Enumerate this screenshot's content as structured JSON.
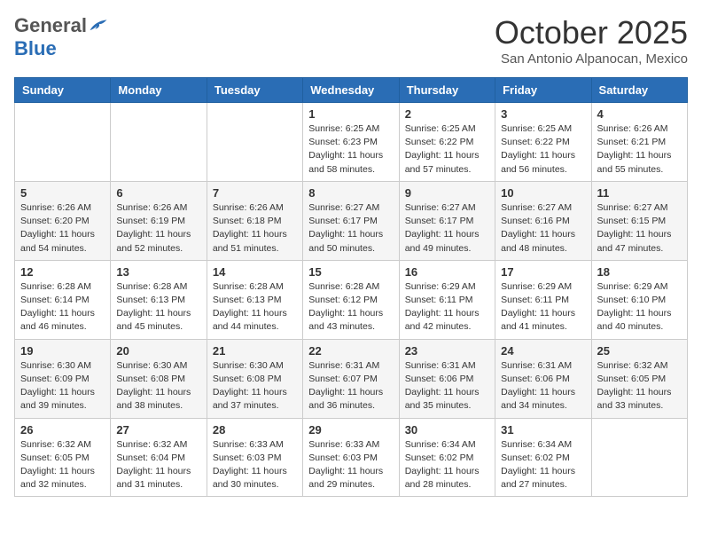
{
  "logo": {
    "general": "General",
    "blue": "Blue"
  },
  "header": {
    "month": "October 2025",
    "location": "San Antonio Alpanocan, Mexico"
  },
  "weekdays": [
    "Sunday",
    "Monday",
    "Tuesday",
    "Wednesday",
    "Thursday",
    "Friday",
    "Saturday"
  ],
  "weeks": [
    [
      {
        "day": "",
        "sunrise": "",
        "sunset": "",
        "daylight": ""
      },
      {
        "day": "",
        "sunrise": "",
        "sunset": "",
        "daylight": ""
      },
      {
        "day": "",
        "sunrise": "",
        "sunset": "",
        "daylight": ""
      },
      {
        "day": "1",
        "sunrise": "Sunrise: 6:25 AM",
        "sunset": "Sunset: 6:23 PM",
        "daylight": "Daylight: 11 hours and 58 minutes."
      },
      {
        "day": "2",
        "sunrise": "Sunrise: 6:25 AM",
        "sunset": "Sunset: 6:22 PM",
        "daylight": "Daylight: 11 hours and 57 minutes."
      },
      {
        "day": "3",
        "sunrise": "Sunrise: 6:25 AM",
        "sunset": "Sunset: 6:22 PM",
        "daylight": "Daylight: 11 hours and 56 minutes."
      },
      {
        "day": "4",
        "sunrise": "Sunrise: 6:26 AM",
        "sunset": "Sunset: 6:21 PM",
        "daylight": "Daylight: 11 hours and 55 minutes."
      }
    ],
    [
      {
        "day": "5",
        "sunrise": "Sunrise: 6:26 AM",
        "sunset": "Sunset: 6:20 PM",
        "daylight": "Daylight: 11 hours and 54 minutes."
      },
      {
        "day": "6",
        "sunrise": "Sunrise: 6:26 AM",
        "sunset": "Sunset: 6:19 PM",
        "daylight": "Daylight: 11 hours and 52 minutes."
      },
      {
        "day": "7",
        "sunrise": "Sunrise: 6:26 AM",
        "sunset": "Sunset: 6:18 PM",
        "daylight": "Daylight: 11 hours and 51 minutes."
      },
      {
        "day": "8",
        "sunrise": "Sunrise: 6:27 AM",
        "sunset": "Sunset: 6:17 PM",
        "daylight": "Daylight: 11 hours and 50 minutes."
      },
      {
        "day": "9",
        "sunrise": "Sunrise: 6:27 AM",
        "sunset": "Sunset: 6:17 PM",
        "daylight": "Daylight: 11 hours and 49 minutes."
      },
      {
        "day": "10",
        "sunrise": "Sunrise: 6:27 AM",
        "sunset": "Sunset: 6:16 PM",
        "daylight": "Daylight: 11 hours and 48 minutes."
      },
      {
        "day": "11",
        "sunrise": "Sunrise: 6:27 AM",
        "sunset": "Sunset: 6:15 PM",
        "daylight": "Daylight: 11 hours and 47 minutes."
      }
    ],
    [
      {
        "day": "12",
        "sunrise": "Sunrise: 6:28 AM",
        "sunset": "Sunset: 6:14 PM",
        "daylight": "Daylight: 11 hours and 46 minutes."
      },
      {
        "day": "13",
        "sunrise": "Sunrise: 6:28 AM",
        "sunset": "Sunset: 6:13 PM",
        "daylight": "Daylight: 11 hours and 45 minutes."
      },
      {
        "day": "14",
        "sunrise": "Sunrise: 6:28 AM",
        "sunset": "Sunset: 6:13 PM",
        "daylight": "Daylight: 11 hours and 44 minutes."
      },
      {
        "day": "15",
        "sunrise": "Sunrise: 6:28 AM",
        "sunset": "Sunset: 6:12 PM",
        "daylight": "Daylight: 11 hours and 43 minutes."
      },
      {
        "day": "16",
        "sunrise": "Sunrise: 6:29 AM",
        "sunset": "Sunset: 6:11 PM",
        "daylight": "Daylight: 11 hours and 42 minutes."
      },
      {
        "day": "17",
        "sunrise": "Sunrise: 6:29 AM",
        "sunset": "Sunset: 6:11 PM",
        "daylight": "Daylight: 11 hours and 41 minutes."
      },
      {
        "day": "18",
        "sunrise": "Sunrise: 6:29 AM",
        "sunset": "Sunset: 6:10 PM",
        "daylight": "Daylight: 11 hours and 40 minutes."
      }
    ],
    [
      {
        "day": "19",
        "sunrise": "Sunrise: 6:30 AM",
        "sunset": "Sunset: 6:09 PM",
        "daylight": "Daylight: 11 hours and 39 minutes."
      },
      {
        "day": "20",
        "sunrise": "Sunrise: 6:30 AM",
        "sunset": "Sunset: 6:08 PM",
        "daylight": "Daylight: 11 hours and 38 minutes."
      },
      {
        "day": "21",
        "sunrise": "Sunrise: 6:30 AM",
        "sunset": "Sunset: 6:08 PM",
        "daylight": "Daylight: 11 hours and 37 minutes."
      },
      {
        "day": "22",
        "sunrise": "Sunrise: 6:31 AM",
        "sunset": "Sunset: 6:07 PM",
        "daylight": "Daylight: 11 hours and 36 minutes."
      },
      {
        "day": "23",
        "sunrise": "Sunrise: 6:31 AM",
        "sunset": "Sunset: 6:06 PM",
        "daylight": "Daylight: 11 hours and 35 minutes."
      },
      {
        "day": "24",
        "sunrise": "Sunrise: 6:31 AM",
        "sunset": "Sunset: 6:06 PM",
        "daylight": "Daylight: 11 hours and 34 minutes."
      },
      {
        "day": "25",
        "sunrise": "Sunrise: 6:32 AM",
        "sunset": "Sunset: 6:05 PM",
        "daylight": "Daylight: 11 hours and 33 minutes."
      }
    ],
    [
      {
        "day": "26",
        "sunrise": "Sunrise: 6:32 AM",
        "sunset": "Sunset: 6:05 PM",
        "daylight": "Daylight: 11 hours and 32 minutes."
      },
      {
        "day": "27",
        "sunrise": "Sunrise: 6:32 AM",
        "sunset": "Sunset: 6:04 PM",
        "daylight": "Daylight: 11 hours and 31 minutes."
      },
      {
        "day": "28",
        "sunrise": "Sunrise: 6:33 AM",
        "sunset": "Sunset: 6:03 PM",
        "daylight": "Daylight: 11 hours and 30 minutes."
      },
      {
        "day": "29",
        "sunrise": "Sunrise: 6:33 AM",
        "sunset": "Sunset: 6:03 PM",
        "daylight": "Daylight: 11 hours and 29 minutes."
      },
      {
        "day": "30",
        "sunrise": "Sunrise: 6:34 AM",
        "sunset": "Sunset: 6:02 PM",
        "daylight": "Daylight: 11 hours and 28 minutes."
      },
      {
        "day": "31",
        "sunrise": "Sunrise: 6:34 AM",
        "sunset": "Sunset: 6:02 PM",
        "daylight": "Daylight: 11 hours and 27 minutes."
      },
      {
        "day": "",
        "sunrise": "",
        "sunset": "",
        "daylight": ""
      }
    ]
  ]
}
